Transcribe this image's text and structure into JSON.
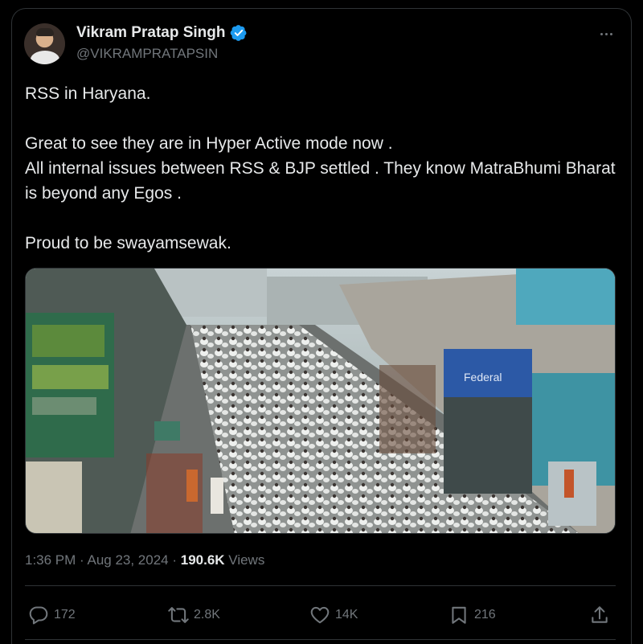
{
  "author": {
    "name": "Vikram Pratap Singh",
    "handle": "@VIKRAMPRATAPSIN",
    "verified": true
  },
  "tweet": {
    "text": "RSS in Haryana.\n\nGreat to see they are in Hyper Active mode now .\nAll internal issues between RSS & BJP settled . They know MatraBhumi Bharat is beyond any Egos .\n\nProud to be swayamsewak.",
    "time": "1:36 PM · Aug 23, 2024 · ",
    "views_count": "190.6K",
    "views_label": " Views"
  },
  "actions": {
    "replies": "172",
    "reposts": "2.8K",
    "likes": "14K",
    "bookmarks": "216"
  },
  "icons": [
    "more-icon",
    "verified-icon",
    "reply-icon",
    "repost-icon",
    "like-icon",
    "bookmark-icon",
    "share-icon"
  ],
  "colors": {
    "background": "#000000",
    "text": "#e7e9ea",
    "muted": "#71767b",
    "verified": "#1d9bf0",
    "border": "#2f3336"
  }
}
